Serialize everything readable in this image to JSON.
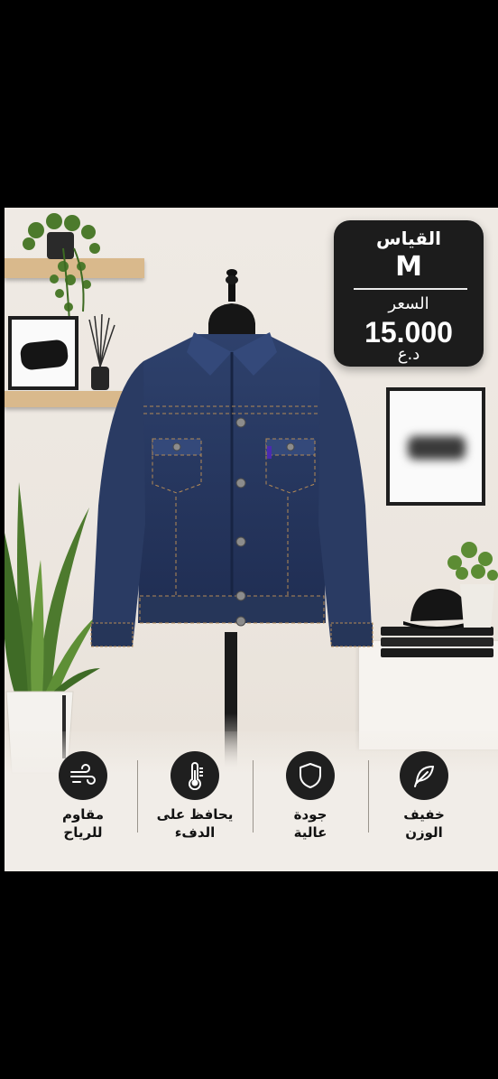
{
  "size": {
    "label": "القياس",
    "value": "M"
  },
  "price": {
    "label": "السعر",
    "value": "15.000",
    "currency": "د.ع"
  },
  "features": [
    {
      "icon": "wind-icon",
      "line1": "مقاوم",
      "line2": "للرياح"
    },
    {
      "icon": "thermometer-icon",
      "line1": "يحافظ على",
      "line2": "الدفء"
    },
    {
      "icon": "shield-icon",
      "line1": "جودة",
      "line2": "عالية"
    },
    {
      "icon": "feather-icon",
      "line1": "خفيف",
      "line2": "الوزن"
    }
  ],
  "colors": {
    "badge": "#1c1c1c",
    "denim": "#2b3c66",
    "background": "#efeae4"
  }
}
